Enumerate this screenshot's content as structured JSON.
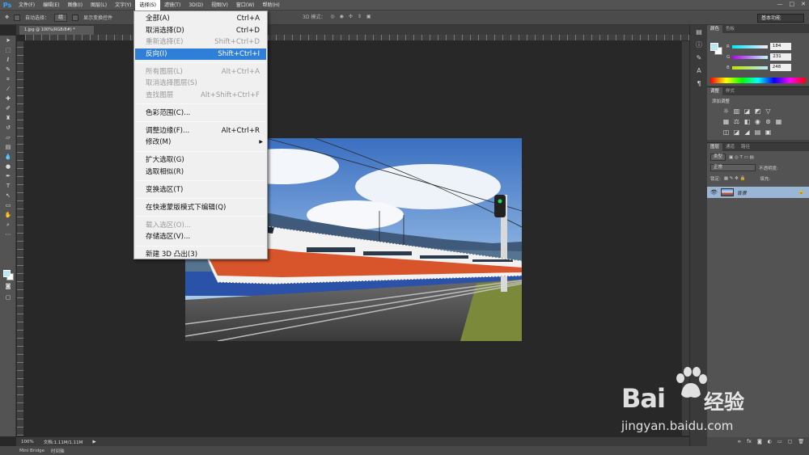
{
  "app": {
    "logo": "Ps"
  },
  "menubar": {
    "items": [
      "文件(F)",
      "编辑(E)",
      "图像(I)",
      "图层(L)",
      "文字(Y)",
      "选择(S)",
      "滤镜(T)",
      "3D(D)",
      "视图(V)",
      "窗口(W)",
      "帮助(H)"
    ],
    "active_index": 5,
    "window_controls": [
      "—",
      "□",
      "✕"
    ]
  },
  "options_bar": {
    "auto_select_label": "自动选择：",
    "auto_select_value": "组",
    "show_transform_label": "显示变换控件",
    "mode_3d_label": "3D 模式：",
    "workspace": "基本功能"
  },
  "document": {
    "tab_title": "1.jpg @ 100%(RGB/8#) *"
  },
  "status": {
    "zoom": "100%",
    "doc_info": "文档:1.11M/1.11M"
  },
  "bottom": {
    "tabs": [
      "Mini Bridge",
      "时间轴"
    ]
  },
  "select_menu": {
    "items": [
      {
        "label": "全部(A)",
        "shortcut": "Ctrl+A",
        "disabled": false
      },
      {
        "label": "取消选择(D)",
        "shortcut": "Ctrl+D",
        "disabled": false
      },
      {
        "label": "重新选择(E)",
        "shortcut": "Shift+Ctrl+D",
        "disabled": true
      },
      {
        "label": "反向(I)",
        "shortcut": "Shift+Ctrl+I",
        "disabled": false,
        "highlighted": true
      },
      {
        "sep": true
      },
      {
        "label": "所有图层(L)",
        "shortcut": "Alt+Ctrl+A",
        "disabled": true
      },
      {
        "label": "取消选择图层(S)",
        "shortcut": "",
        "disabled": true
      },
      {
        "label": "查找图层",
        "shortcut": "Alt+Shift+Ctrl+F",
        "disabled": true
      },
      {
        "sep": true
      },
      {
        "label": "色彩范围(C)...",
        "shortcut": "",
        "disabled": false
      },
      {
        "sep": true
      },
      {
        "label": "调整边缘(F)...",
        "shortcut": "Alt+Ctrl+R",
        "disabled": false
      },
      {
        "label": "修改(M)",
        "shortcut": "",
        "disabled": false,
        "submenu": true
      },
      {
        "sep": true
      },
      {
        "label": "扩大选取(G)",
        "shortcut": "",
        "disabled": false
      },
      {
        "label": "选取相似(R)",
        "shortcut": "",
        "disabled": false
      },
      {
        "sep": true
      },
      {
        "label": "变换选区(T)",
        "shortcut": "",
        "disabled": false
      },
      {
        "sep": true
      },
      {
        "label": "在快速蒙版模式下编辑(Q)",
        "shortcut": "",
        "disabled": false
      },
      {
        "sep": true
      },
      {
        "label": "载入选区(O)...",
        "shortcut": "",
        "disabled": true
      },
      {
        "label": "存储选区(V)...",
        "shortcut": "",
        "disabled": false
      },
      {
        "sep": true
      },
      {
        "label": "新建 3D 凸出(3)",
        "shortcut": "",
        "disabled": false
      }
    ]
  },
  "color_panel": {
    "tabs": [
      "颜色",
      "色板"
    ],
    "r_label": "R",
    "g_label": "G",
    "b_label": "B",
    "r": "184",
    "g": "231",
    "b": "248",
    "foreground": "#b8e7f8"
  },
  "adjust_panel": {
    "tabs": [
      "调整",
      "样式"
    ],
    "title": "添加调整"
  },
  "layers_panel": {
    "tabs": [
      "图层",
      "通道",
      "路径"
    ],
    "kind": "类型",
    "blend": "正常",
    "opacity_label": "不透明度:",
    "lock_label": "锁定:",
    "fill_label": "填充:",
    "layer_name": "背景"
  },
  "watermark": {
    "brand": "Bai",
    "cn": "经验",
    "url": "jingyan.baidu.com"
  },
  "colors": {
    "accent": "#2f7fd9",
    "ps_blue": "#31a8ff"
  }
}
